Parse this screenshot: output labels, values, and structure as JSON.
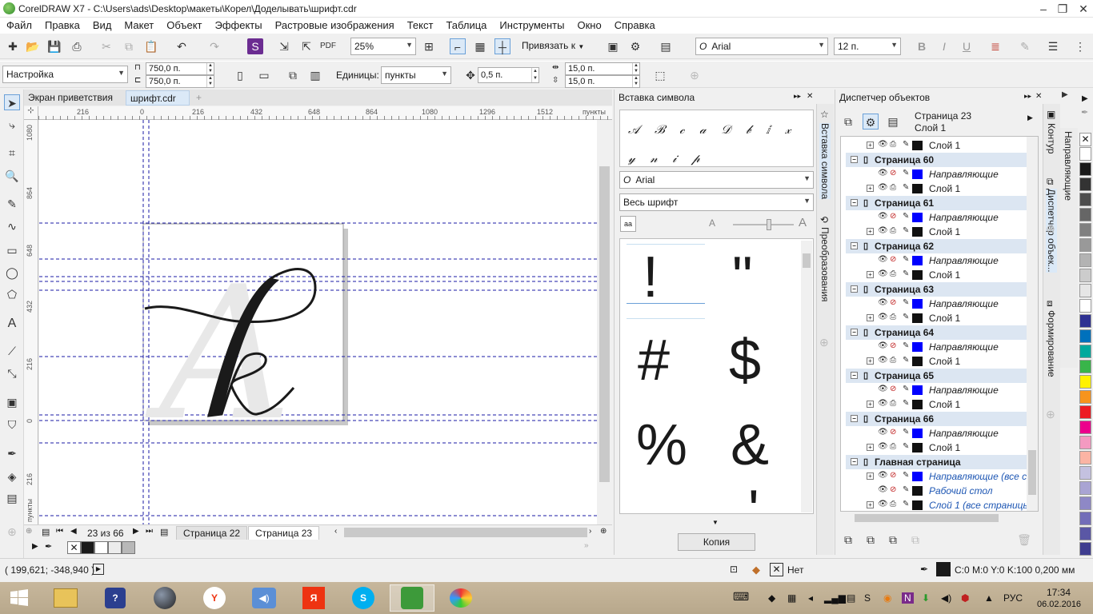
{
  "window": {
    "title": "CorelDRAW X7 - C:\\Users\\ads\\Desktop\\макеты\\Корел\\Доделывать\\шрифт.cdr"
  },
  "menu": [
    "Файл",
    "Правка",
    "Вид",
    "Макет",
    "Объект",
    "Эффекты",
    "Растровые изображения",
    "Текст",
    "Таблица",
    "Инструменты",
    "Окно",
    "Справка"
  ],
  "toolbar": {
    "zoom": "25%",
    "snap_label": "Привязать к",
    "font": "Arial",
    "font_size": "12 п."
  },
  "propbar": {
    "preset": "Настройка",
    "width": "750,0 п.",
    "height": "750,0 п.",
    "units_label": "Единицы:",
    "units_value": "пункты",
    "nudge": "0,5 п.",
    "dup_x": "15,0 п.",
    "dup_y": "15,0 п."
  },
  "doc_tabs": [
    "Экран приветствия",
    "шрифт.cdr"
  ],
  "ruler": {
    "h_ticks": [
      "216",
      "0",
      "216",
      "432",
      "648",
      "864",
      "1080",
      "1296",
      "1512"
    ],
    "h_unit": "пункты",
    "v_ticks": [
      "1080",
      "864",
      "648",
      "432",
      "216",
      "0",
      "216"
    ],
    "v_unit": "пункты"
  },
  "page_nav": {
    "counter": "23 из 66",
    "tabs": [
      "Страница 22",
      "Страница 23"
    ]
  },
  "symbol_docker": {
    "title": "Вставка символа",
    "font": "Arial",
    "subset": "Весь шрифт",
    "glyphs": [
      "!",
      "\"",
      "#",
      "$",
      "%",
      "&",
      "'"
    ],
    "copy_button": "Копия",
    "recent_glyphs": [
      "𝒜",
      "ℬ",
      "𝒸",
      "𝒶",
      "𝒟",
      "𝒷",
      "ⅈ",
      "𝓍",
      "𝓎",
      "𝓃",
      "𝒾",
      "𝓅"
    ]
  },
  "side_tabs_left": [
    "Вставка символа",
    "Преобразования"
  ],
  "side_tabs_right": [
    "Контур",
    "Диспетчер объек...",
    "Формирование"
  ],
  "side_tabs_far": [
    "Направляющие"
  ],
  "object_manager": {
    "title": "Диспетчер объектов",
    "current_page": "Страница 23",
    "current_layer": "Слой 1",
    "rows": [
      {
        "type": "layer",
        "label": "Слой 1",
        "color": "#111111"
      },
      {
        "type": "page",
        "label": "Страница 60"
      },
      {
        "type": "guides",
        "label": "Направляющие",
        "color": "#0000ff"
      },
      {
        "type": "layer",
        "label": "Слой 1",
        "color": "#111111"
      },
      {
        "type": "page",
        "label": "Страница 61"
      },
      {
        "type": "guides",
        "label": "Направляющие",
        "color": "#0000ff"
      },
      {
        "type": "layer",
        "label": "Слой 1",
        "color": "#111111"
      },
      {
        "type": "page",
        "label": "Страница 62"
      },
      {
        "type": "guides",
        "label": "Направляющие",
        "color": "#0000ff"
      },
      {
        "type": "layer",
        "label": "Слой 1",
        "color": "#111111"
      },
      {
        "type": "page",
        "label": "Страница 63"
      },
      {
        "type": "guides",
        "label": "Направляющие",
        "color": "#0000ff"
      },
      {
        "type": "layer",
        "label": "Слой 1",
        "color": "#111111"
      },
      {
        "type": "page",
        "label": "Страница 64"
      },
      {
        "type": "guides",
        "label": "Направляющие",
        "color": "#0000ff"
      },
      {
        "type": "layer",
        "label": "Слой 1",
        "color": "#111111"
      },
      {
        "type": "page",
        "label": "Страница 65"
      },
      {
        "type": "guides",
        "label": "Направляющие",
        "color": "#0000ff"
      },
      {
        "type": "layer",
        "label": "Слой 1",
        "color": "#111111"
      },
      {
        "type": "page",
        "label": "Страница 66"
      },
      {
        "type": "guides",
        "label": "Направляющие",
        "color": "#0000ff"
      },
      {
        "type": "layer",
        "label": "Слой 1",
        "color": "#111111"
      },
      {
        "type": "page",
        "label": "Главная страница"
      },
      {
        "type": "master-guides",
        "label": "Направляющие (все с",
        "color": "#0000ff"
      },
      {
        "type": "master-desktop",
        "label": "Рабочий стол",
        "color": "#111111"
      },
      {
        "type": "master-layer",
        "label": "Слой 1 (все страницы",
        "color": "#111111"
      }
    ]
  },
  "status": {
    "coords": "( 199,621; -348,940 )",
    "fill_label": "Нет",
    "outline": "C:0 M:0 Y:0 K:100  0,200 мм"
  },
  "palette": [
    "#ffffff",
    "#1a1a1a",
    "#333333",
    "#4d4d4d",
    "#666666",
    "#808080",
    "#999999",
    "#b3b3b3",
    "#cccccc",
    "#e6e6e6",
    "#ffffff",
    "#2e3192",
    "#0071bc",
    "#00a99d",
    "#39b54a",
    "#fff200",
    "#f7941d",
    "#ed1c24",
    "#ec008c",
    "#f49ac1",
    "#fbb4a4",
    "#c4c1e0",
    "#a9a4d3",
    "#8e88c6",
    "#726db8",
    "#5a57a5",
    "#3f3d8f"
  ],
  "taskbar": {
    "lang": "РУС",
    "time": "17:34",
    "date": "06.02.2016"
  }
}
